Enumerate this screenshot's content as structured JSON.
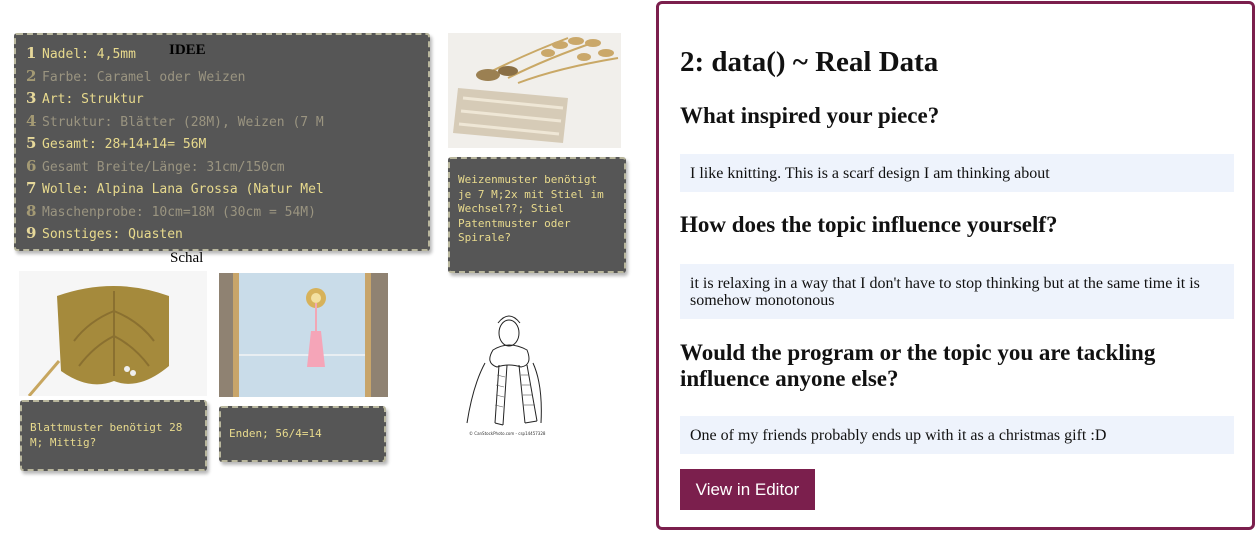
{
  "board": {
    "code_lines": [
      {
        "num": "1",
        "text": "Nadel: 4,5mm",
        "dim": false
      },
      {
        "num": "2",
        "text": "Farbe: Caramel oder Weizen",
        "dim": true
      },
      {
        "num": "3",
        "text": "Art: Struktur",
        "dim": false
      },
      {
        "num": "4",
        "text": "Struktur: Blätter (28M), Weizen (7 M",
        "dim": true
      },
      {
        "num": "5",
        "text": "Gesamt: 28+14+14= 56M",
        "dim": false
      },
      {
        "num": "6",
        "text": "Gesamt Breite/Länge: 31cm/150cm",
        "dim": true
      },
      {
        "num": "7",
        "text": "Wolle: Alpina Lana Grossa (Natur Mel",
        "dim": false
      },
      {
        "num": "8",
        "text": "Maschenprobe: 10cm=18M (30cm = 54M)",
        "dim": true
      },
      {
        "num": "9",
        "text": "Sonstiges: Quasten",
        "dim": false
      }
    ],
    "idee_label": "IDEE",
    "schal_label": "Schal",
    "weizen_note": "Weizenmuster benötigt je 7 M;2x mit Stiel im Wechsel??; Stiel Patentmuster oder Spirale?",
    "blatt_note": "Blattmuster benötigt 28 M; Mittig?",
    "enden_note": "Enden; 56/4=14",
    "sketch_caption": "© CanStockPhoto.com - csp14457328"
  },
  "panel": {
    "title": "2: data() ~ Real Data",
    "questions": [
      {
        "q": "What inspired your piece?",
        "a": "I like knitting. This is a scarf design I am thinking about"
      },
      {
        "q": "How does the topic influence yourself?",
        "a": "it is relaxing in a way that I don't have to stop thinking but at the same time it is somehow monotonous"
      },
      {
        "q": "Would the program or the topic you are tackling influence anyone else?",
        "a": "One of my friends probably ends up with it as a christmas gift :D"
      }
    ],
    "button_label": "View in Editor"
  },
  "colors": {
    "accent": "#7b1f4d",
    "note_bg": "#565656",
    "note_text": "#e8da8d",
    "answer_bg": "#eef3fc"
  }
}
